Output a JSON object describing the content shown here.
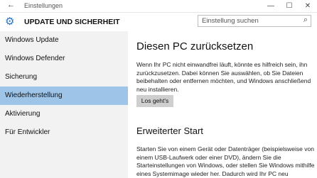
{
  "window": {
    "back_glyph": "←",
    "title": "Einstellungen",
    "minimize_glyph": "—",
    "maximize_glyph": "☐",
    "close_glyph": "✕"
  },
  "header": {
    "gear_glyph": "⚙",
    "title": "UPDATE UND SICHERHEIT",
    "search_placeholder": "Einstellung suchen",
    "search_glyph": "⌕"
  },
  "sidebar": {
    "items": [
      {
        "label": "Windows Update"
      },
      {
        "label": "Windows Defender"
      },
      {
        "label": "Sicherung"
      },
      {
        "label": "Wiederherstellung",
        "selected": true
      },
      {
        "label": "Aktivierung"
      },
      {
        "label": "Für Entwickler"
      }
    ]
  },
  "main": {
    "reset_title": "Diesen PC zurücksetzen",
    "reset_text": "Wenn Ihr PC nicht einwandfrei läuft, könnte es hilfreich sein, ihn zurückzusetzen. Dabei können Sie auswählen, ob Sie Dateien beibehalten oder entfernen möchten, und Windows anschließend neu installieren.",
    "reset_button": "Los geht's",
    "advanced_title": "Erweiterter Start",
    "advanced_text": "Starten Sie von einem Gerät oder Datenträger (beispielsweise von einem USB-Laufwerk oder einer DVD), ändern Sie die Starteinstellungen von Windows, oder stellen Sie Windows mithilfe eines Systemimage wieder her. Dadurch wird Ihr PC neu"
  },
  "colors": {
    "accent": "#2b73c7",
    "selected_bg": "#9ec4e8",
    "sidebar_bg": "#f2f2f2",
    "button_bg": "#cfcfcf"
  }
}
